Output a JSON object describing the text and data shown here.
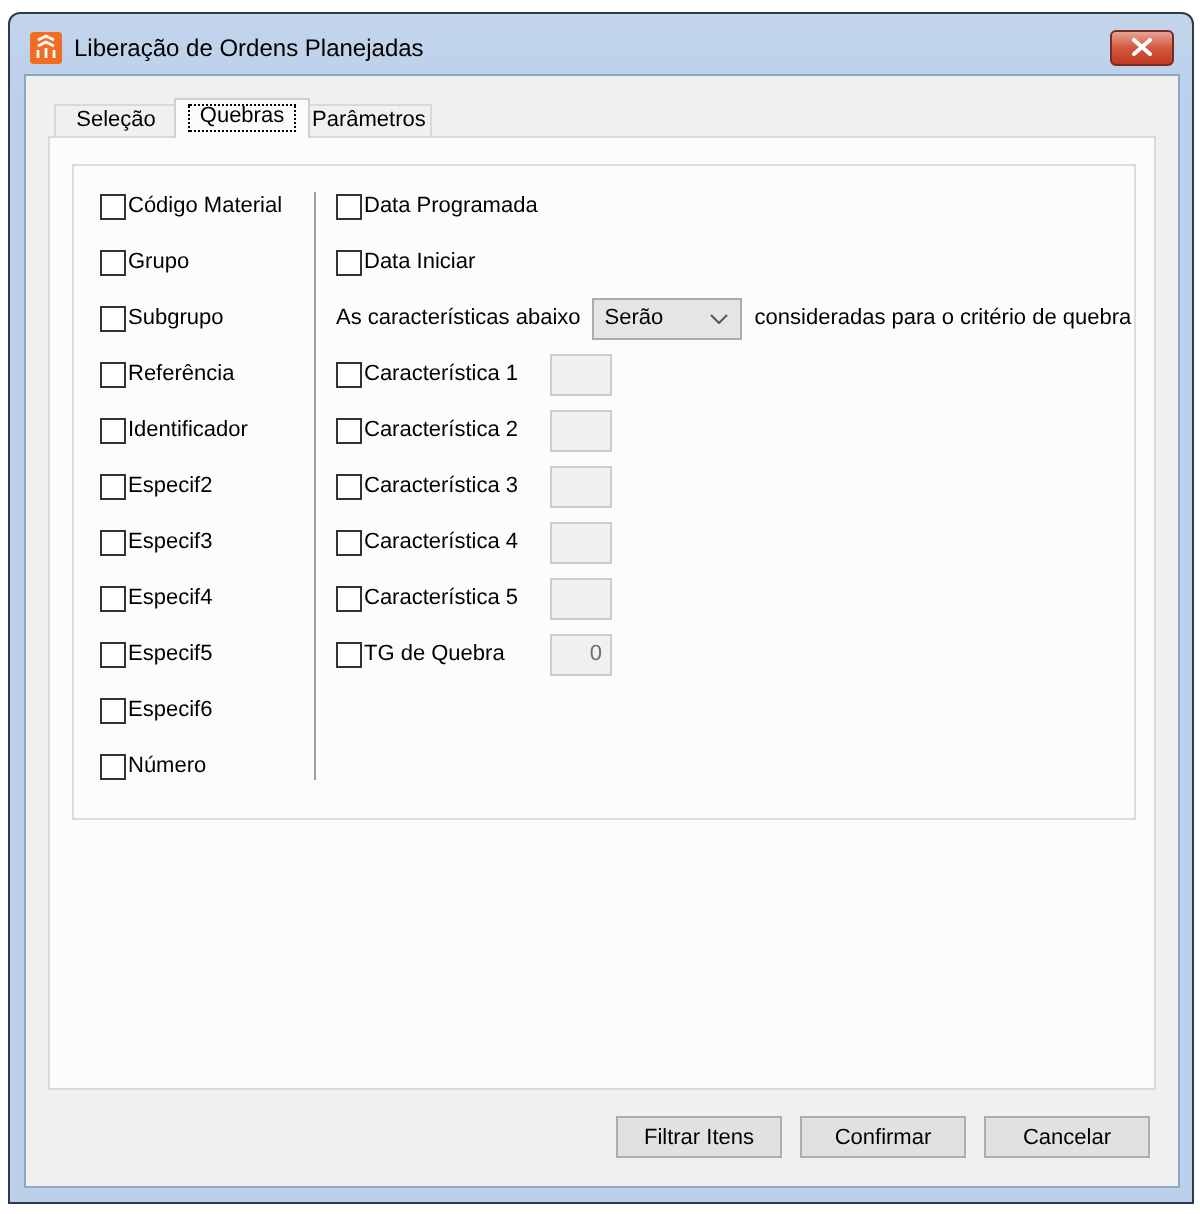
{
  "window": {
    "title": "Liberação de Ordens Planejadas"
  },
  "tabs": [
    {
      "label": "Seleção",
      "selected": false
    },
    {
      "label": "Quebras",
      "selected": true
    },
    {
      "label": "Parâmetros",
      "selected": false
    }
  ],
  "break_fields": [
    {
      "label": "Código Material",
      "checked": false
    },
    {
      "label": "Grupo",
      "checked": false
    },
    {
      "label": "Subgrupo",
      "checked": false
    },
    {
      "label": "Referência",
      "checked": false
    },
    {
      "label": "Identificador",
      "checked": false
    },
    {
      "label": "Especif2",
      "checked": false
    },
    {
      "label": "Especif3",
      "checked": false
    },
    {
      "label": "Especif4",
      "checked": false
    },
    {
      "label": "Especif5",
      "checked": false
    },
    {
      "label": "Especif6",
      "checked": false
    },
    {
      "label": "Número",
      "checked": false
    }
  ],
  "date_options": [
    {
      "label": "Data Programada",
      "checked": false
    },
    {
      "label": "Data Iniciar",
      "checked": false
    }
  ],
  "characteristics_rule": {
    "prefix": "As características abaixo",
    "dropdown_value": "Serão",
    "suffix": "consideradas para o critério de quebra"
  },
  "characteristic_fields": [
    {
      "label": "Característica 1",
      "checked": false,
      "disabled": true
    },
    {
      "label": "Característica 2",
      "checked": false,
      "disabled": true
    },
    {
      "label": "Característica 3",
      "checked": false,
      "disabled": true
    },
    {
      "label": "Característica 4",
      "checked": false,
      "disabled": true
    },
    {
      "label": "Característica 5",
      "checked": false,
      "disabled": true
    },
    {
      "label": "TG de Quebra",
      "checked": false,
      "disabled": true,
      "value": "0"
    }
  ],
  "buttons": [
    "Filtrar Itens",
    "Confirmar",
    "Cancelar"
  ]
}
